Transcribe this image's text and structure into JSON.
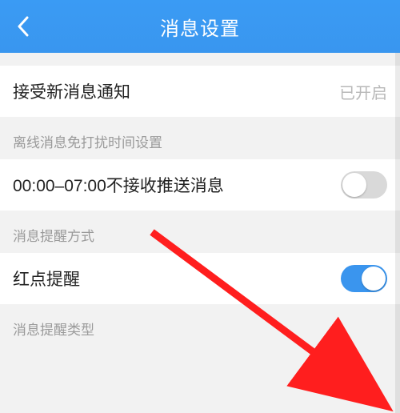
{
  "header": {
    "title": "消息设置"
  },
  "rows": {
    "accept_new": {
      "label": "接受新消息通知",
      "value": "已开启"
    },
    "dnd_header": "离线消息免打扰时间设置",
    "dnd_row": {
      "label": "00:00–07:00不接收推送消息"
    },
    "alert_mode_header": "消息提醒方式",
    "alert_mode_row": {
      "label": "红点提醒"
    },
    "alert_type_header": "消息提醒类型"
  },
  "toggles": {
    "dnd": false,
    "red_dot": true
  }
}
